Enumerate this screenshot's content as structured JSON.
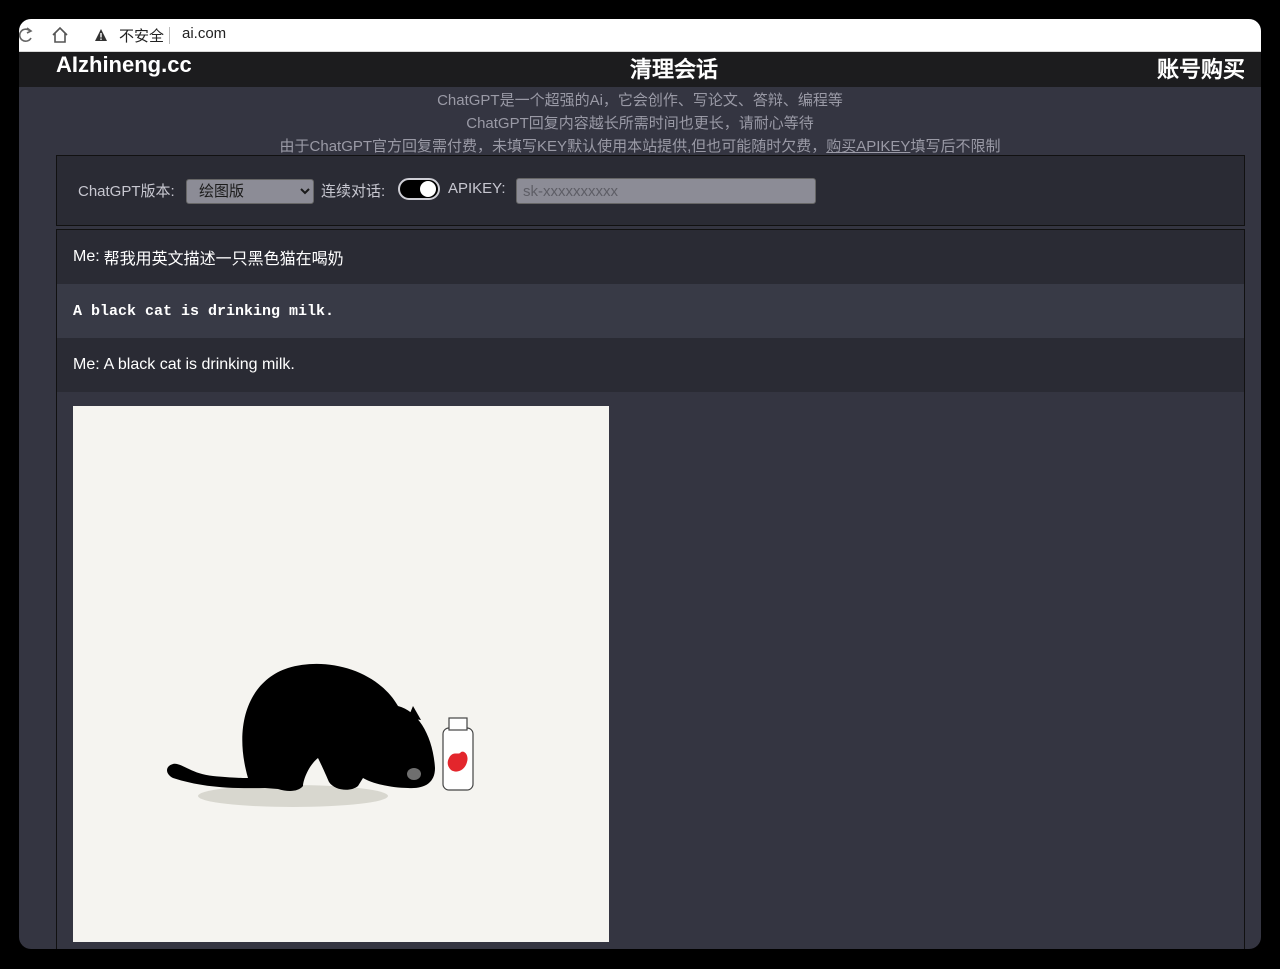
{
  "browser": {
    "security_label": "不安全",
    "url": "ai.com"
  },
  "header": {
    "logo": "AIzhineng.cc",
    "clear_label": "清理会话",
    "buy_label": "账号购买"
  },
  "notice": {
    "line1": "ChatGPT是一个超强的Ai，它会创作、写论文、答辩、编程等",
    "line2": "ChatGPT回复内容越长所需时间也更长，请耐心等待",
    "line3_prefix": "由于ChatGPT官方回复需付费，未填写KEY默认使用本站提供,但也可能随时欠费，",
    "line3_link": "购买APIKEY",
    "line3_suffix": "填写后不限制"
  },
  "settings": {
    "version_label": "ChatGPT版本:",
    "version_value": "绘图版",
    "continuous_label": "连续对话:",
    "continuous_on": true,
    "apikey_label": "APIKEY:",
    "apikey_placeholder": "sk-xxxxxxxxxx"
  },
  "messages": [
    {
      "role": "me",
      "prefix": "Me:",
      "text": "帮我用英文描述一只黑色猫在喝奶"
    },
    {
      "role": "bot",
      "prefix": "",
      "text": "A black cat is drinking milk."
    },
    {
      "role": "me",
      "prefix": "Me:",
      "text": "A black cat is drinking milk."
    }
  ],
  "colors": {
    "page_bg": "#343541",
    "header_bg": "#1c1c1e",
    "me_row_bg": "#2a2b34",
    "bot_row_bg": "#383a46",
    "image_bg": "#f5f4f0",
    "milk_label": "#e3262c"
  }
}
